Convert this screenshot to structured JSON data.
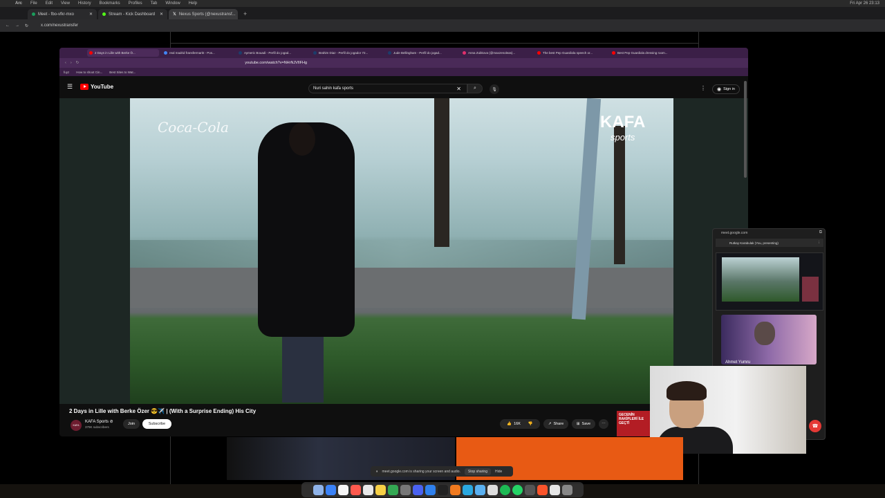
{
  "menubar": {
    "items": [
      "Arc",
      "File",
      "Edit",
      "View",
      "History",
      "Bookmarks",
      "Profiles",
      "Tab",
      "Window",
      "Help"
    ],
    "clock": "Fri Apr 26 23:13"
  },
  "outer_tabs": [
    {
      "label": "Meet - fbo-vfkr-mxo",
      "color": "#1a9e5c"
    },
    {
      "label": "Stream - Kick Dashboard",
      "color": "#53fc18"
    },
    {
      "label": "Nexus Sports (@nexustransf...",
      "color": "#ffffff"
    }
  ],
  "outer_url": "x.com/nexustransfer",
  "inner_tabs": [
    {
      "label": "2 Days in Lille with Berke Ö...",
      "color": "#ff0000"
    },
    {
      "label": "real madrid fransfermarkt - Pos...",
      "color": "#4285f4"
    },
    {
      "label": "Aymeric Bouadi - Perfil do jogad...",
      "color": "#1c3c6b"
    },
    {
      "label": "Brahim Diaz - Perfil do jogador 72...",
      "color": "#1c3c6b"
    },
    {
      "label": "Jude Bellingham - Perfil do jogad...",
      "color": "#1c3c6b"
    },
    {
      "label": "Anna Zubkova (@maxzenoleas)...",
      "color": "#e1306c"
    },
    {
      "label": "The best Pep Guardiola speech or...",
      "color": "#ff0000"
    },
    {
      "label": "Best Pep Guardiola dressing room...",
      "color": "#ff0000"
    }
  ],
  "inner_url": "youtube.com/watch?v=NHrNJVIlFHg",
  "bookmarks": [
    "fuyz",
    "How to shoot Cin...",
    "Best Sites to Wat..."
  ],
  "youtube": {
    "logo": "YouTube",
    "search_value": "Nuri sahin kafa sports",
    "sign_in": "Sign in"
  },
  "video": {
    "watermark_left": "Coca-Cola",
    "watermark_right_top": "KAFA",
    "watermark_right_bottom": "sports",
    "title": "2 Days in Lille with Berke Özer 😎✈️ | (With a Surprise Ending) His City",
    "channel": "KAFA Sports ⊘",
    "subscribers": "379K subscribers",
    "join": "Join",
    "subscribe": "Subscribe",
    "likes": "16K",
    "share": "Share",
    "save": "Save",
    "ad_text": "GECENİN RAKİPLERİ İLE GEÇTİ"
  },
  "meet": {
    "url": "meet.google.com",
    "presenter": "Rutkay Karabulak (You, presenting)",
    "participant": "Ahmet Yumru"
  },
  "share_bar": {
    "message": "meet.google.com is sharing your screen and audio.",
    "stop": "Stop sharing",
    "hide": "Hide"
  },
  "colors": {
    "inner_tab_bg": "#3b1f47",
    "youtube_red": "#ff0000",
    "subscribe_bg": "#ffffff"
  }
}
